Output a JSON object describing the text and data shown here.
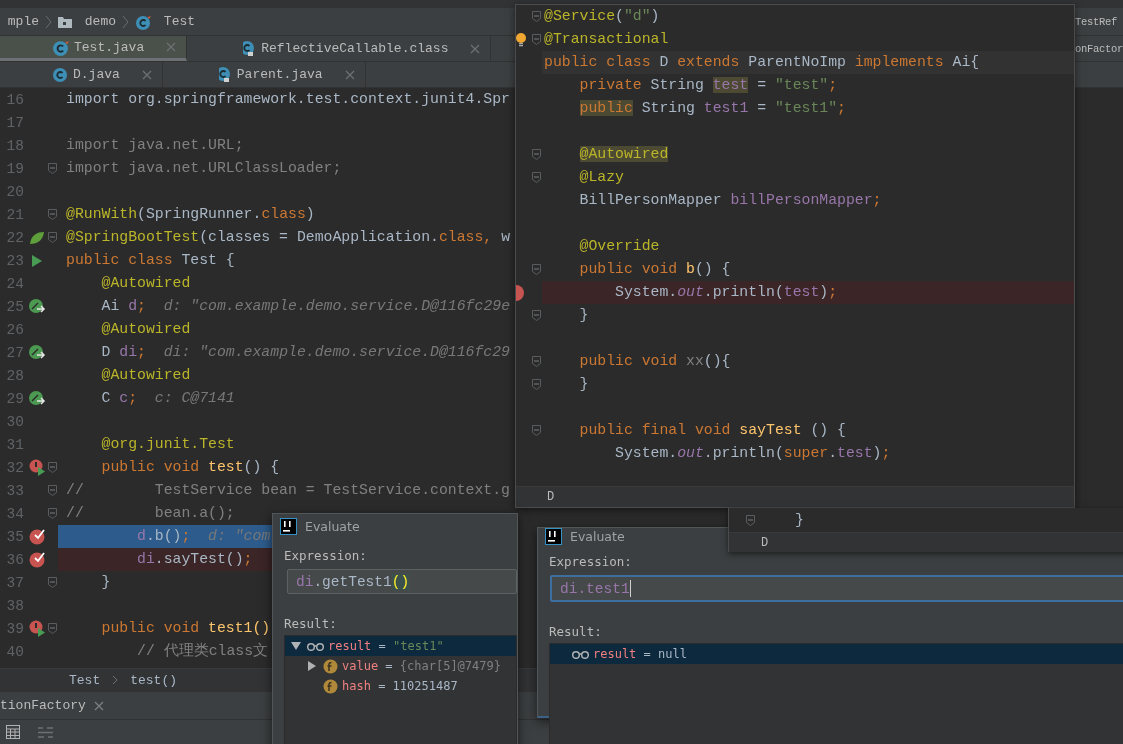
{
  "navigation_bar": {
    "items": [
      {
        "kind": "package",
        "label": "mple"
      },
      {
        "kind": "folder",
        "label": "demo"
      },
      {
        "kind": "test-class",
        "label": "Test"
      }
    ],
    "side_tab": "TestRef"
  },
  "tab_rows": [
    {
      "tabs": [
        {
          "label": "Test.java",
          "kind": "test-class",
          "selected": true
        },
        {
          "label": "ReflectiveCallable.class",
          "kind": "compiled",
          "selected": false
        }
      ],
      "side_tab": "onFactor"
    },
    {
      "tabs": [
        {
          "label": "D.java",
          "kind": "class",
          "selected": false
        },
        {
          "label": "Parent.java",
          "kind": "compiled",
          "selected": false
        }
      ]
    }
  ],
  "editor": {
    "lines": [
      {
        "number": "16",
        "fold": false,
        "tokens": [
          {
            "kind": "plain",
            "text": "import org.springframework.test.context.junit4.Spr"
          }
        ]
      },
      {
        "number": "17",
        "fold": false
      },
      {
        "number": "18",
        "fold": false,
        "tokens": [
          {
            "kind": "unused",
            "text": "import java.net.URL;"
          }
        ]
      },
      {
        "number": "19",
        "fold": true,
        "tokens": [
          {
            "kind": "unused",
            "text": "import java.net.URLClassLoader;"
          }
        ]
      },
      {
        "number": "20",
        "fold": false
      },
      {
        "number": "21",
        "fold": true,
        "tokens": [
          {
            "kind": "annotation",
            "text": "@RunWith"
          },
          {
            "kind": "plain",
            "text": "(SpringRunner."
          },
          {
            "kind": "keyword",
            "text": "class"
          },
          {
            "kind": "plain",
            "text": ")"
          }
        ]
      },
      {
        "number": "22",
        "fold": true,
        "gutter_icon": {
          "kind": "leaf"
        },
        "tokens": [
          {
            "kind": "annotation",
            "text": "@SpringBootTest"
          },
          {
            "kind": "plain",
            "text": "(classes = DemoApplication."
          },
          {
            "kind": "keyword",
            "text": "class, "
          },
          {
            "kind": "plain",
            "text": "w"
          }
        ]
      },
      {
        "number": "23",
        "fold": false,
        "gutter_icon": {
          "kind": "run"
        },
        "tokens": [
          {
            "kind": "keyword",
            "text": "public class "
          },
          {
            "kind": "plain",
            "text": "Test {"
          }
        ]
      },
      {
        "number": "24",
        "fold": false,
        "tokens": [
          {
            "kind": "annotation",
            "text": "    @Autowired"
          }
        ]
      },
      {
        "number": "25",
        "fold": false,
        "gutter_icon": {
          "kind": "bean"
        },
        "tokens": [
          {
            "kind": "plain",
            "text": "    Ai "
          },
          {
            "kind": "field",
            "text": "d"
          },
          {
            "kind": "keyword",
            "text": ";"
          },
          {
            "kind": "hint",
            "text": "  d: \"com.example.demo.service.D@116fc29e"
          }
        ]
      },
      {
        "number": "26",
        "fold": false,
        "tokens": [
          {
            "kind": "annotation",
            "text": "    @Autowired"
          }
        ]
      },
      {
        "number": "27",
        "fold": false,
        "gutter_icon": {
          "kind": "bean"
        },
        "tokens": [
          {
            "kind": "plain",
            "text": "    D "
          },
          {
            "kind": "field",
            "text": "di"
          },
          {
            "kind": "keyword",
            "text": ";"
          },
          {
            "kind": "hint",
            "text": "  di: \"com.example.demo.service.D@116fc29"
          }
        ]
      },
      {
        "number": "28",
        "fold": false,
        "tokens": [
          {
            "kind": "annotation",
            "text": "    @Autowired"
          }
        ]
      },
      {
        "number": "29",
        "fold": false,
        "gutter_icon": {
          "kind": "bean"
        },
        "tokens": [
          {
            "kind": "plain",
            "text": "    C "
          },
          {
            "kind": "field",
            "text": "c"
          },
          {
            "kind": "keyword",
            "text": ";"
          },
          {
            "kind": "hint",
            "text": "  c: C@7141"
          }
        ]
      },
      {
        "number": "30",
        "fold": false
      },
      {
        "number": "31",
        "fold": false,
        "tokens": [
          {
            "kind": "annotation",
            "text": "    @org.junit.Test"
          }
        ]
      },
      {
        "number": "32",
        "fold": true,
        "gutter_icon": {
          "kind": "run-error"
        },
        "tokens": [
          {
            "kind": "keyword",
            "text": "    public void "
          },
          {
            "kind": "method",
            "text": "test"
          },
          {
            "kind": "plain",
            "text": "() {"
          }
        ]
      },
      {
        "number": "33",
        "fold": true,
        "tokens": [
          {
            "kind": "comment",
            "text": "//        TestService bean = TestService.context.g"
          }
        ]
      },
      {
        "number": "34",
        "fold": true,
        "tokens": [
          {
            "kind": "comment",
            "text": "//        bean.a();"
          }
        ]
      },
      {
        "number": "35",
        "fold": false,
        "gutter_icon": {
          "kind": "breakpoint-hit"
        },
        "highlight": {
          "kind": "execution"
        },
        "tokens": [
          {
            "kind": "field",
            "text": "        d"
          },
          {
            "kind": "plain",
            "text": ".b()"
          },
          {
            "kind": "keyword",
            "text": ";"
          },
          {
            "kind": "hint",
            "text": "  d: \"com"
          }
        ]
      },
      {
        "number": "36",
        "fold": false,
        "gutter_icon": {
          "kind": "breakpoint-hit"
        },
        "highlight": {
          "kind": "breakpoint"
        },
        "tokens": [
          {
            "kind": "field",
            "text": "        di"
          },
          {
            "kind": "plain",
            "text": ".sayTest()"
          },
          {
            "kind": "keyword",
            "text": ";"
          }
        ]
      },
      {
        "number": "37",
        "fold": true,
        "tokens": [
          {
            "kind": "plain",
            "text": "    }"
          }
        ]
      },
      {
        "number": "38",
        "fold": false
      },
      {
        "number": "39",
        "fold": true,
        "gutter_icon": {
          "kind": "run-error"
        },
        "tokens": [
          {
            "kind": "keyword",
            "text": "    public void "
          },
          {
            "kind": "method",
            "text": "test1()"
          }
        ]
      },
      {
        "number": "40",
        "fold": false,
        "tokens": [
          {
            "kind": "comment",
            "text": "        // 代理类class文"
          }
        ]
      }
    ]
  },
  "code_breadcrumb": [
    "Test",
    "test()"
  ],
  "tool_tab": {
    "label": "tionFactory"
  },
  "class_popup": {
    "lines": [
      {
        "fold": true,
        "tokens": [
          {
            "kind": "annotation",
            "text": "@Service"
          },
          {
            "kind": "plain",
            "text": "("
          },
          {
            "kind": "string",
            "text": "\"d\""
          },
          {
            "kind": "plain",
            "text": ")"
          }
        ]
      },
      {
        "fold": true,
        "gutter_icon": {
          "kind": "bulb"
        },
        "tokens": [
          {
            "kind": "annotation",
            "text": "@Transactional"
          }
        ]
      },
      {
        "fold": false,
        "highlight": {
          "kind": "caret"
        },
        "tokens": [
          {
            "kind": "keyword",
            "text": "public class "
          },
          {
            "kind": "plain",
            "text": "D "
          },
          {
            "kind": "keyword",
            "text": "extends "
          },
          {
            "kind": "plain",
            "text": "ParentNoImp "
          },
          {
            "kind": "keyword",
            "text": "implements "
          },
          {
            "kind": "plain",
            "text": "Ai{"
          }
        ]
      },
      {
        "fold": false,
        "tokens": [
          {
            "kind": "keyword",
            "text": "    private "
          },
          {
            "kind": "plain",
            "text": "String "
          },
          {
            "kind": "field",
            "text": "test",
            "marked": true
          },
          {
            "kind": "plain",
            "text": " = "
          },
          {
            "kind": "string",
            "text": "\"test\""
          },
          {
            "kind": "keyword",
            "text": ";"
          }
        ]
      },
      {
        "fold": false,
        "tokens": [
          {
            "kind": "keyword",
            "text": "    public",
            "marked": true
          },
          {
            "kind": "plain",
            "text": " String "
          },
          {
            "kind": "field",
            "text": "test1"
          },
          {
            "kind": "plain",
            "text": " = "
          },
          {
            "kind": "string",
            "text": "\"test1\""
          },
          {
            "kind": "keyword",
            "text": ";"
          }
        ]
      },
      {
        "fold": false
      },
      {
        "fold": true,
        "tokens": [
          {
            "kind": "annotation",
            "text": "    @Autowired",
            "marked": true
          }
        ]
      },
      {
        "fold": true,
        "tokens": [
          {
            "kind": "annotation",
            "text": "    @Lazy"
          }
        ]
      },
      {
        "fold": false,
        "tokens": [
          {
            "kind": "plain",
            "text": "    BillPersonMapper "
          },
          {
            "kind": "field",
            "text": "billPersonMapper"
          },
          {
            "kind": "keyword",
            "text": ";"
          }
        ]
      },
      {
        "fold": false
      },
      {
        "fold": false,
        "tokens": [
          {
            "kind": "annotation",
            "text": "    @Override"
          }
        ]
      },
      {
        "fold": true,
        "tokens": [
          {
            "kind": "keyword",
            "text": "    public void "
          },
          {
            "kind": "method",
            "text": "b"
          },
          {
            "kind": "plain",
            "text": "() {"
          }
        ]
      },
      {
        "fold": false,
        "gutter_icon": {
          "kind": "breakpoint"
        },
        "highlight": {
          "kind": "breakpoint"
        },
        "tokens": [
          {
            "kind": "plain",
            "text": "        System."
          },
          {
            "kind": "static",
            "text": "out"
          },
          {
            "kind": "plain",
            "text": ".println("
          },
          {
            "kind": "field",
            "text": "test"
          },
          {
            "kind": "plain",
            "text": ")"
          },
          {
            "kind": "keyword",
            "text": ";"
          }
        ]
      },
      {
        "fold": true,
        "tokens": [
          {
            "kind": "plain",
            "text": "    }"
          }
        ]
      },
      {
        "fold": false
      },
      {
        "fold": true,
        "tokens": [
          {
            "kind": "keyword",
            "text": "    public void "
          },
          {
            "kind": "unused",
            "text": "xx"
          },
          {
            "kind": "plain",
            "text": "(){"
          }
        ]
      },
      {
        "fold": true,
        "tokens": [
          {
            "kind": "plain",
            "text": "    }"
          }
        ]
      },
      {
        "fold": false
      },
      {
        "fold": true,
        "tokens": [
          {
            "kind": "keyword",
            "text": "    public final void "
          },
          {
            "kind": "method",
            "text": "sayTest"
          },
          {
            "kind": "plain",
            "text": " () {"
          }
        ]
      },
      {
        "fold": false,
        "tokens": [
          {
            "kind": "plain",
            "text": "        System."
          },
          {
            "kind": "static",
            "text": "out"
          },
          {
            "kind": "plain",
            "text": ".println("
          },
          {
            "kind": "keyword",
            "text": "super"
          },
          {
            "kind": "plain",
            "text": "."
          },
          {
            "kind": "field",
            "text": "test"
          },
          {
            "kind": "plain",
            "text": ")"
          },
          {
            "kind": "keyword",
            "text": ";"
          }
        ]
      }
    ],
    "status": "D"
  },
  "evaluate_dialogs": [
    {
      "title": "Evaluate",
      "expression_label": "Expression:",
      "focused": false,
      "expression": [
        {
          "kind": "field",
          "text": "di"
        },
        {
          "kind": "plain",
          "text": ".getTest1"
        },
        {
          "kind": "paren",
          "text": "()"
        }
      ],
      "result_label": "Result:",
      "results": [
        {
          "kind": "result",
          "name": "result",
          "separator": "=",
          "value": {
            "kind": "string",
            "text": "\"test1\""
          },
          "expanded": true,
          "selected": true,
          "children": [
            {
              "kind": "field",
              "name": "value",
              "separator": "=",
              "value": {
                "kind": "object",
                "text": "{char[5]@7479}"
              },
              "expanded": false,
              "selected": false
            },
            {
              "kind": "field",
              "name": "hash",
              "separator": "=",
              "value": {
                "kind": "number",
                "text": "110251487"
              },
              "selected": false
            }
          ]
        }
      ]
    },
    {
      "title": "Evaluate",
      "expression_label": "Expression:",
      "focused": true,
      "expression": [
        {
          "kind": "field",
          "text": "di.test1"
        }
      ],
      "result_label": "Result:",
      "results": [
        {
          "kind": "result",
          "name": "result",
          "separator": "=",
          "value": {
            "kind": "number",
            "text": "null"
          },
          "selected": true
        }
      ]
    }
  ],
  "mini_popup": {
    "line": "}",
    "status": "D"
  }
}
